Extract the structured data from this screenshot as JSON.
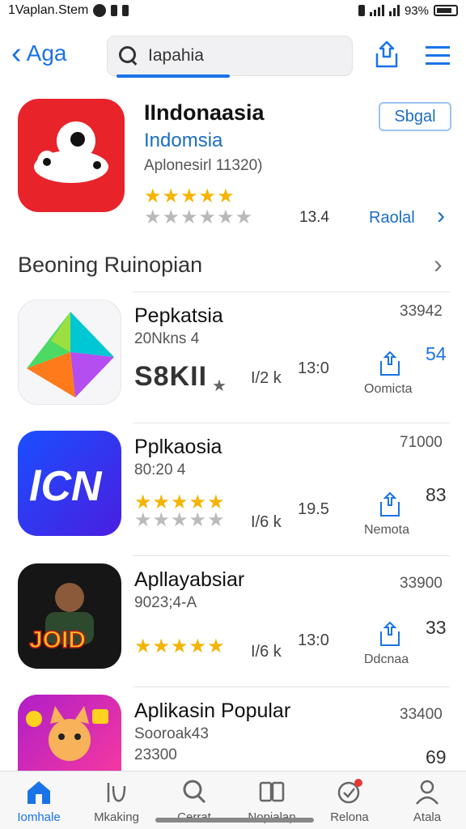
{
  "status_bar": {
    "carrier": "1Vaplan.Stem",
    "battery": "93%"
  },
  "header": {
    "back_label": "Aga",
    "search_value": "Iapahia"
  },
  "featured": {
    "title": "IIndonaasia",
    "subtitle": "Indomsia",
    "meta": "Aplonesirl 11320)",
    "stars_gold": "★★★★★",
    "stars_grey": "★★★★★★",
    "rating": "13.4",
    "button_label": "Sbgal",
    "link_label": "Raolal"
  },
  "section": {
    "title": "Beoning Ruinopian"
  },
  "apps": [
    {
      "title": "Pepkatsia",
      "subtitle": "20Nkns 4",
      "big_value": "S8KII",
      "star_mark": "★",
      "size": "I/2 k",
      "num": "13:0",
      "count": "33942",
      "dl_label": "Oomicta",
      "right_num": "54"
    },
    {
      "title": "Pplkaosia",
      "subtitle": "80:20 4",
      "stars_gold": "★★★★★",
      "stars_grey": "★★★★★",
      "size": "I/6 k",
      "num": "19.5",
      "count": "71000",
      "dl_label": "Nemota",
      "right_num": "83"
    },
    {
      "title": "Apllayabsiar",
      "subtitle": "9023;4-A",
      "stars_gold": "★★★★★",
      "size": "I/6 k",
      "num": "13:0",
      "count": "33900",
      "dl_label": "Ddcnaa",
      "right_num": "33",
      "icon_text": "JOID"
    },
    {
      "title": "Aplikasin Popular",
      "subtitle": "Sooroak43",
      "subtitle2": "23300",
      "count": "33400",
      "right_num": "69"
    }
  ],
  "bottom_nav": [
    {
      "label": "Iomhale",
      "icon": "home-icon"
    },
    {
      "label": "Mkaking",
      "icon": "apps-icon"
    },
    {
      "label": "Cerrat",
      "icon": "search-icon"
    },
    {
      "label": "Nopialap",
      "icon": "library-icon"
    },
    {
      "label": "Relona",
      "icon": "updates-icon"
    },
    {
      "label": "Atala",
      "icon": "profile-icon"
    }
  ],
  "colors": {
    "accent": "#1a73e8",
    "star": "#f4b400",
    "featured_icon": "#e8232a"
  }
}
